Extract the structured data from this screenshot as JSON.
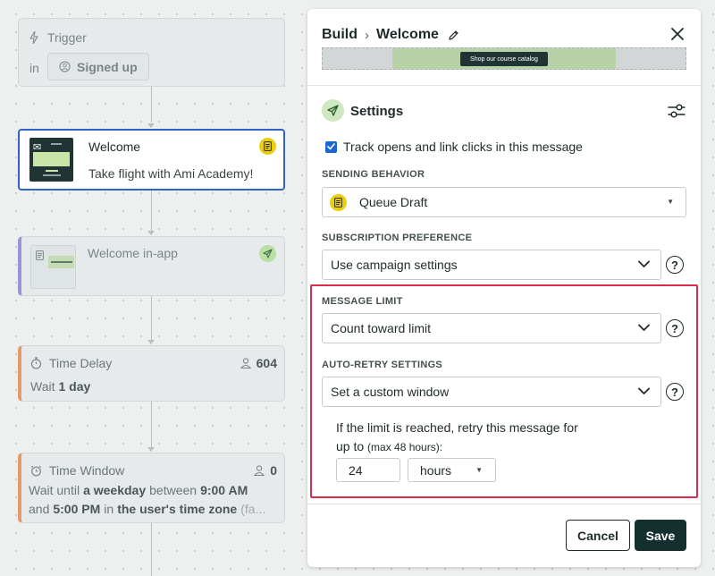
{
  "canvas": {
    "trigger": {
      "title": "Trigger",
      "in_label": "in",
      "segment": "Signed up"
    },
    "welcome": {
      "name": "Welcome",
      "subject": "Take flight with Ami Academy!"
    },
    "inapp": {
      "name": "Welcome in-app"
    },
    "delay": {
      "title": "Time Delay",
      "count": "604",
      "wait_prefix": "Wait",
      "wait_value": "1 day"
    },
    "window": {
      "title": "Time Window",
      "count": "0",
      "line1_a": "Wait until",
      "line1_b": "a weekday",
      "line1_c": "between",
      "line1_d": "9:00 AM",
      "line2_a": "and",
      "line2_b": "5:00 PM",
      "line2_c": "in",
      "line2_d": "the user's time zone",
      "line2_e": "(fa..."
    }
  },
  "panel": {
    "breadcrumb": {
      "parent": "Build",
      "separator": "›",
      "current": "Welcome"
    },
    "preview_button": "Shop our course catalog",
    "settings_title": "Settings",
    "track_label": "Track opens and link clicks in this message",
    "track_checked": true,
    "sending": {
      "label": "SENDING BEHAVIOR",
      "value": "Queue Draft"
    },
    "subscription": {
      "label": "SUBSCRIPTION PREFERENCE",
      "value": "Use campaign settings"
    },
    "message_limit": {
      "label": "MESSAGE LIMIT",
      "value": "Count toward limit"
    },
    "auto_retry": {
      "label": "AUTO-RETRY SETTINGS",
      "value": "Set a custom window",
      "help_text_1": "If the limit is reached, retry this message for",
      "help_text_2": "up to",
      "help_text_small": "(max 48 hours):",
      "amount": "24",
      "unit": "hours"
    },
    "help_glyph": "?",
    "buttons": {
      "cancel": "Cancel",
      "save": "Save"
    }
  },
  "colors": {
    "accent_blue": "#2f63c6",
    "highlight_red": "#d92d4a",
    "save_bg": "#14302e",
    "draft_yellow": "#e9cf13",
    "inapp_purple": "#9b93d6",
    "delay_orange": "#e49b6a"
  },
  "icons": {
    "trigger": "lightning-icon",
    "segment": "segment-icon",
    "email": "envelope-icon",
    "draft": "document-icon",
    "inapp": "paper-plane-icon",
    "timer": "stopwatch-icon",
    "window": "alarm-clock-icon",
    "people": "person-icon",
    "edit": "pencil-icon",
    "close": "close-icon",
    "settings": "paper-plane-icon",
    "tune": "sliders-icon"
  }
}
